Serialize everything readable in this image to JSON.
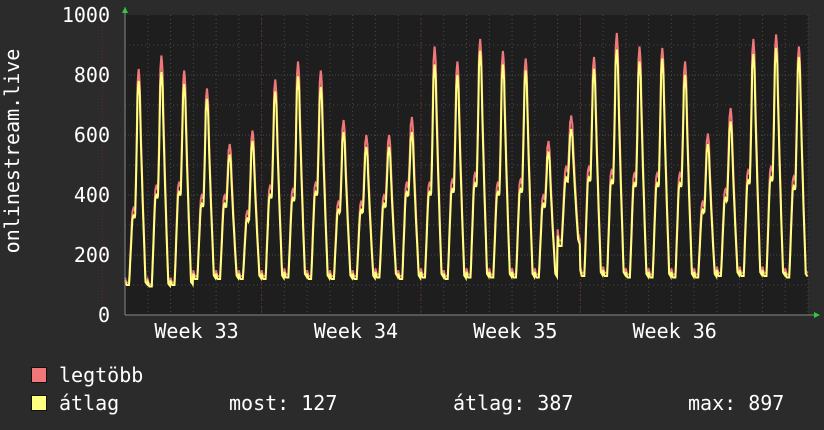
{
  "colors": {
    "background": "#2b2b2b",
    "plot_bg": "#1e1e1e",
    "grid": "#4a4a4a",
    "week_grid": "#6b2a2a",
    "axis": "#888888",
    "text": "#ffffff",
    "series_max": "#f07878",
    "series_avg": "#ffff80"
  },
  "chart_data": {
    "type": "line",
    "ylabel": "onlinestream.live",
    "ylim": [
      0,
      1000
    ],
    "yticks": [
      0,
      200,
      400,
      600,
      800,
      1000
    ],
    "x_range_days": [
      0,
      29
    ],
    "week_ticks": [
      {
        "label": "Week 33",
        "day": 2
      },
      {
        "label": "Week 34",
        "day": 9
      },
      {
        "label": "Week 35",
        "day": 16
      },
      {
        "label": "Week 36",
        "day": 23
      }
    ],
    "grid": true,
    "days": [
      {
        "peak_max": 820,
        "peak_avg": 780,
        "min": 100,
        "bump_max": 340
      },
      {
        "peak_max": 865,
        "peak_avg": 810,
        "min": 95,
        "bump_max": 410
      },
      {
        "peak_max": 815,
        "peak_avg": 770,
        "min": 100,
        "bump_max": 420
      },
      {
        "peak_max": 755,
        "peak_avg": 720,
        "min": 120,
        "bump_max": 380
      },
      {
        "peak_max": 570,
        "peak_avg": 535,
        "min": 120,
        "bump_max": 380
      },
      {
        "peak_max": 615,
        "peak_avg": 580,
        "min": 120,
        "bump_max": 330
      },
      {
        "peak_max": 785,
        "peak_avg": 745,
        "min": 120,
        "bump_max": 410
      },
      {
        "peak_max": 845,
        "peak_avg": 795,
        "min": 125,
        "bump_max": 400
      },
      {
        "peak_max": 815,
        "peak_avg": 760,
        "min": 120,
        "bump_max": 420
      },
      {
        "peak_max": 650,
        "peak_avg": 610,
        "min": 120,
        "bump_max": 360
      },
      {
        "peak_max": 600,
        "peak_avg": 560,
        "min": 120,
        "bump_max": 360
      },
      {
        "peak_max": 600,
        "peak_avg": 560,
        "min": 125,
        "bump_max": 380
      },
      {
        "peak_max": 660,
        "peak_avg": 610,
        "min": 120,
        "bump_max": 420
      },
      {
        "peak_max": 895,
        "peak_avg": 835,
        "min": 125,
        "bump_max": 420
      },
      {
        "peak_max": 845,
        "peak_avg": 800,
        "min": 120,
        "bump_max": 430
      },
      {
        "peak_max": 920,
        "peak_avg": 880,
        "min": 125,
        "bump_max": 450
      },
      {
        "peak_max": 880,
        "peak_avg": 835,
        "min": 125,
        "bump_max": 420
      },
      {
        "peak_max": 855,
        "peak_avg": 815,
        "min": 125,
        "bump_max": 430
      },
      {
        "peak_max": 580,
        "peak_avg": 545,
        "min": 125,
        "bump_max": 380
      },
      {
        "peak_max": 665,
        "peak_avg": 620,
        "min": 230,
        "bump_max": 470
      },
      {
        "peak_max": 860,
        "peak_avg": 820,
        "min": 130,
        "bump_max": 470
      },
      {
        "peak_max": 940,
        "peak_avg": 885,
        "min": 130,
        "bump_max": 460
      },
      {
        "peak_max": 895,
        "peak_avg": 845,
        "min": 125,
        "bump_max": 450
      },
      {
        "peak_max": 890,
        "peak_avg": 855,
        "min": 125,
        "bump_max": 450
      },
      {
        "peak_max": 845,
        "peak_avg": 800,
        "min": 125,
        "bump_max": 450
      },
      {
        "peak_max": 605,
        "peak_avg": 570,
        "min": 125,
        "bump_max": 360
      },
      {
        "peak_max": 690,
        "peak_avg": 645,
        "min": 130,
        "bump_max": 400
      },
      {
        "peak_max": 920,
        "peak_avg": 870,
        "min": 130,
        "bump_max": 460
      },
      {
        "peak_max": 935,
        "peak_avg": 890,
        "min": 130,
        "bump_max": 470
      },
      {
        "peak_max": 895,
        "peak_avg": 860,
        "min": 125,
        "bump_max": 440
      }
    ],
    "series": [
      {
        "name": "legtöbb",
        "key": "max"
      },
      {
        "name": "átlag",
        "key": "avg"
      }
    ]
  },
  "legend": {
    "max_label": "legtöbb",
    "avg_label": "átlag",
    "most": "most: 127",
    "atlag": "átlag: 387",
    "max": "max: 897"
  }
}
